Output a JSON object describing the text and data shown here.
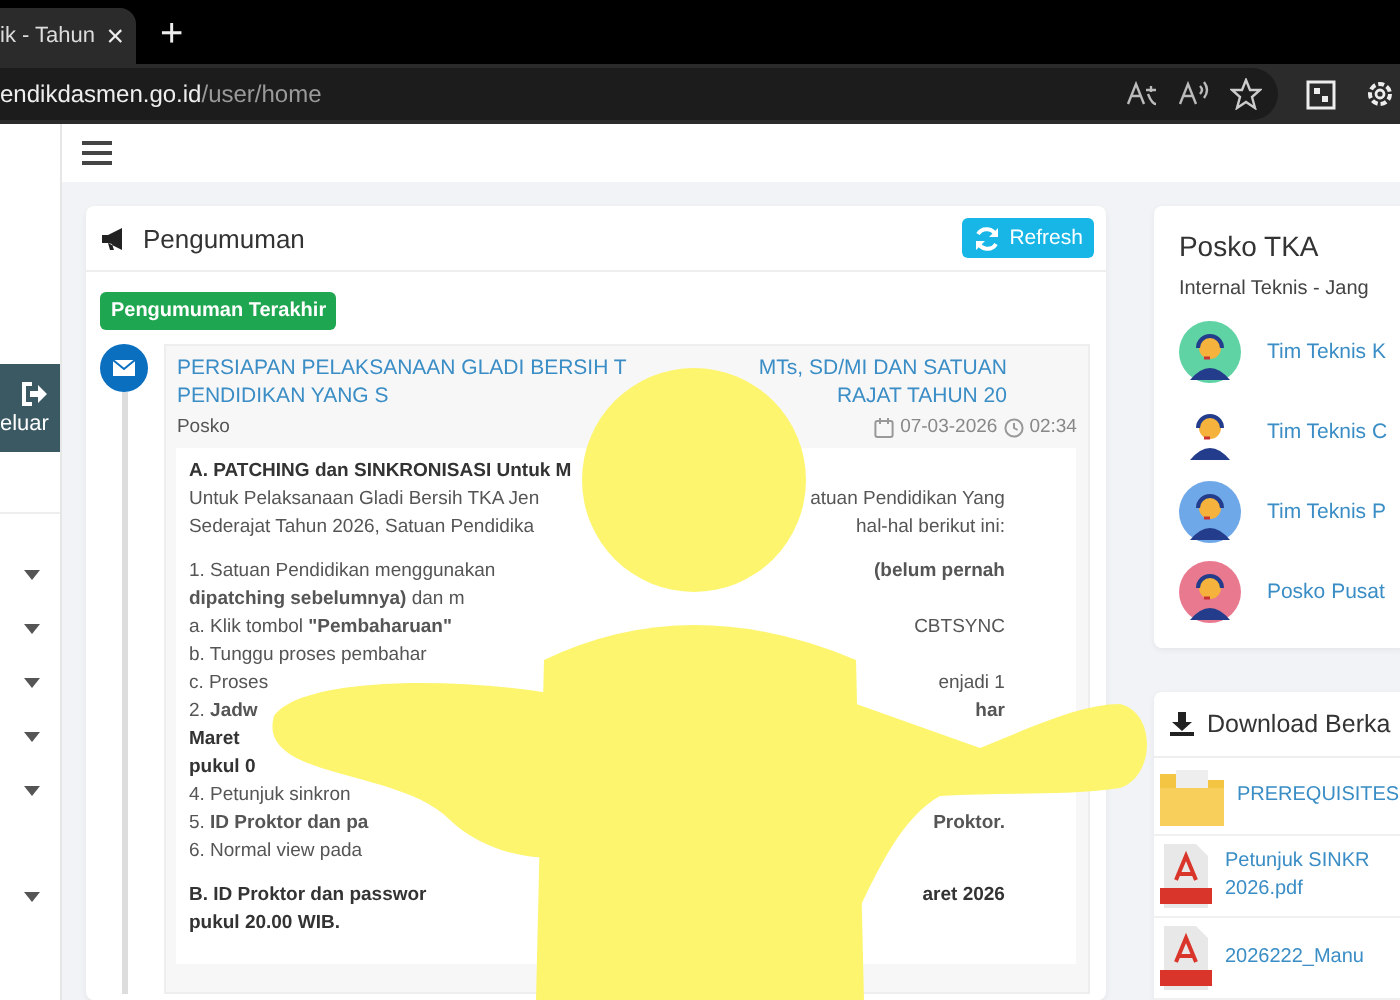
{
  "browser": {
    "tab": {
      "title": "ik - Tahun",
      "close": "×"
    },
    "new_tab": "+",
    "address": {
      "domain": "endikdasmen.go.id",
      "path": "/user/home"
    }
  },
  "sidebar": {
    "logout_label": "eluar"
  },
  "announcements": {
    "title": "Pengumuman",
    "refresh": "Refresh",
    "badge": "Pengumuman Terakhir",
    "post": {
      "title_lines": [
        [
          "PERSIAPAN PELAKSANAAN GLADI BERSIH T",
          "MTs, SD/MI DAN SATUAN"
        ],
        [
          "PENDIDIKAN YANG S",
          "RAJAT TAHUN 20"
        ]
      ],
      "author": "Posko",
      "date": "07-03-2026",
      "time": "02:34",
      "paragraphs": [
        [
          {
            "kind": "bold",
            "parts": [
              "A. PATCHING dan SINKRONISASI Untuk M"
            ]
          },
          {
            "kind": "normal",
            "parts": [
              "Untuk Pelaksanaan Gladi Bersih TKA Jen",
              "atuan Pendidikan Yang"
            ]
          },
          {
            "kind": "normal",
            "parts": [
              "Sederajat Tahun 2026, Satuan Pendidika",
              "hal-hal berikut ini:"
            ]
          }
        ],
        [
          {
            "kind": "normal",
            "parts": [
              "1. Satuan Pendidikan menggunakan",
              "**(belum pernah**"
            ]
          },
          {
            "kind": "normal",
            "parts": [
              "**dipatching sebelumnya)** dan m"
            ]
          },
          {
            "kind": "normal",
            "parts": [
              "a. Klik tombol **\"Pembaharuan\"**",
              "CBTSYNC"
            ]
          },
          {
            "kind": "normal",
            "parts": [
              "b. Tunggu proses pembahar"
            ]
          },
          {
            "kind": "normal",
            "parts": [
              "c. Proses",
              "enjadi 1"
            ]
          },
          {
            "kind": "normal",
            "parts": [
              "2. **Jadw**",
              "**har**"
            ]
          },
          {
            "kind": "bold",
            "parts": [
              "Maret"
            ]
          },
          {
            "kind": "bold",
            "parts": [
              "pukul 0"
            ]
          },
          {
            "kind": "normal",
            "parts": [
              "4. Petunjuk sinkron"
            ]
          },
          {
            "kind": "normal",
            "parts": [
              "5. **ID Proktor dan pa**",
              "**Proktor.**"
            ]
          },
          {
            "kind": "normal",
            "parts": [
              "6. Normal view pada"
            ]
          }
        ],
        [
          {
            "kind": "bold",
            "parts": [
              "B. ID Proktor dan passwor",
              "aret 2026"
            ]
          },
          {
            "kind": "bold",
            "parts": [
              "pukul 20.00 WIB."
            ]
          }
        ]
      ]
    }
  },
  "posko": {
    "title": "Posko TKA",
    "subtitle": "Internal Teknis - Jang",
    "contacts": [
      {
        "name": "Tim Teknis K",
        "color": "#5fd3a4"
      },
      {
        "name": "Tim Teknis C",
        "color": "#ffffff"
      },
      {
        "name": "Tim Teknis P",
        "color": "#6fa8e8"
      },
      {
        "name": "Posko Pusat",
        "color": "#e9798f"
      }
    ]
  },
  "downloads": {
    "title": "Download Berka",
    "files": [
      {
        "kind": "folder",
        "lines": [
          "PREREQUISITES"
        ]
      },
      {
        "kind": "pdf",
        "lines": [
          "Petunjuk SINKR",
          "2026.pdf"
        ]
      },
      {
        "kind": "pdf",
        "lines": [
          "2026222_Manu"
        ]
      }
    ]
  }
}
